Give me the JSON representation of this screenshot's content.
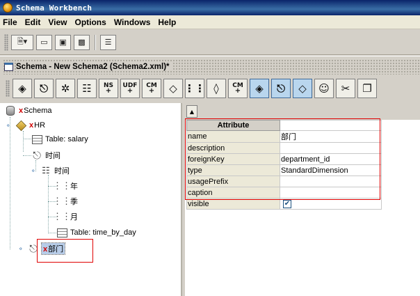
{
  "window": {
    "title": "Schema Workbench"
  },
  "menu": [
    "File",
    "Edit",
    "View",
    "Options",
    "Windows",
    "Help"
  ],
  "main_toolbar": {
    "buttons": [
      "new-icon",
      "open-icon",
      "save-icon",
      "save-all-icon",
      "preferences-icon"
    ]
  },
  "frame": {
    "title": "Schema - New Schema2 (Schema2.xml)*"
  },
  "schema_toolbar": {
    "buttons": [
      {
        "icon": "cube-icon",
        "text": ""
      },
      {
        "icon": "dimension-icon",
        "text": ""
      },
      {
        "icon": "dimension-usage-icon",
        "text": ""
      },
      {
        "icon": "hierarchy-icon",
        "text": ""
      },
      {
        "icon": "named-set-icon",
        "text": "NS"
      },
      {
        "icon": "udf-icon",
        "text": "UDF"
      },
      {
        "icon": "calculated-member-icon",
        "text": "CM"
      },
      {
        "icon": "measure-icon",
        "text": ""
      },
      {
        "icon": "level-icon",
        "text": ""
      },
      {
        "icon": "property-icon",
        "text": ""
      },
      {
        "icon": "calculated-member-property-icon",
        "text": "CM"
      },
      {
        "icon": "virtual-cube-icon",
        "text": ""
      },
      {
        "icon": "virtual-dimension-icon",
        "text": ""
      },
      {
        "icon": "virtual-measure-icon",
        "text": ""
      },
      {
        "icon": "role-icon",
        "text": ""
      },
      {
        "icon": "cut-icon",
        "text": ""
      },
      {
        "icon": "copy-icon",
        "text": ""
      }
    ]
  },
  "tree": {
    "schema": "Schema",
    "cube": "HR",
    "table_salary": "Table: salary",
    "dim_time": "时间",
    "hier_time": "时间",
    "level_year": "年",
    "level_quarter": "季",
    "level_month": "月",
    "table_time": "Table: time_by_day",
    "dim_dept": "部门",
    "error_mark": "x"
  },
  "attributes": {
    "header": "Attribute",
    "rows": [
      {
        "key": "name",
        "value": "部门"
      },
      {
        "key": "description",
        "value": ""
      },
      {
        "key": "foreignKey",
        "value": "department_id"
      },
      {
        "key": "type",
        "value": "StandardDimension"
      },
      {
        "key": "usagePrefix",
        "value": ""
      },
      {
        "key": "caption",
        "value": ""
      },
      {
        "key": "visible",
        "value": "",
        "checked": true
      }
    ]
  }
}
